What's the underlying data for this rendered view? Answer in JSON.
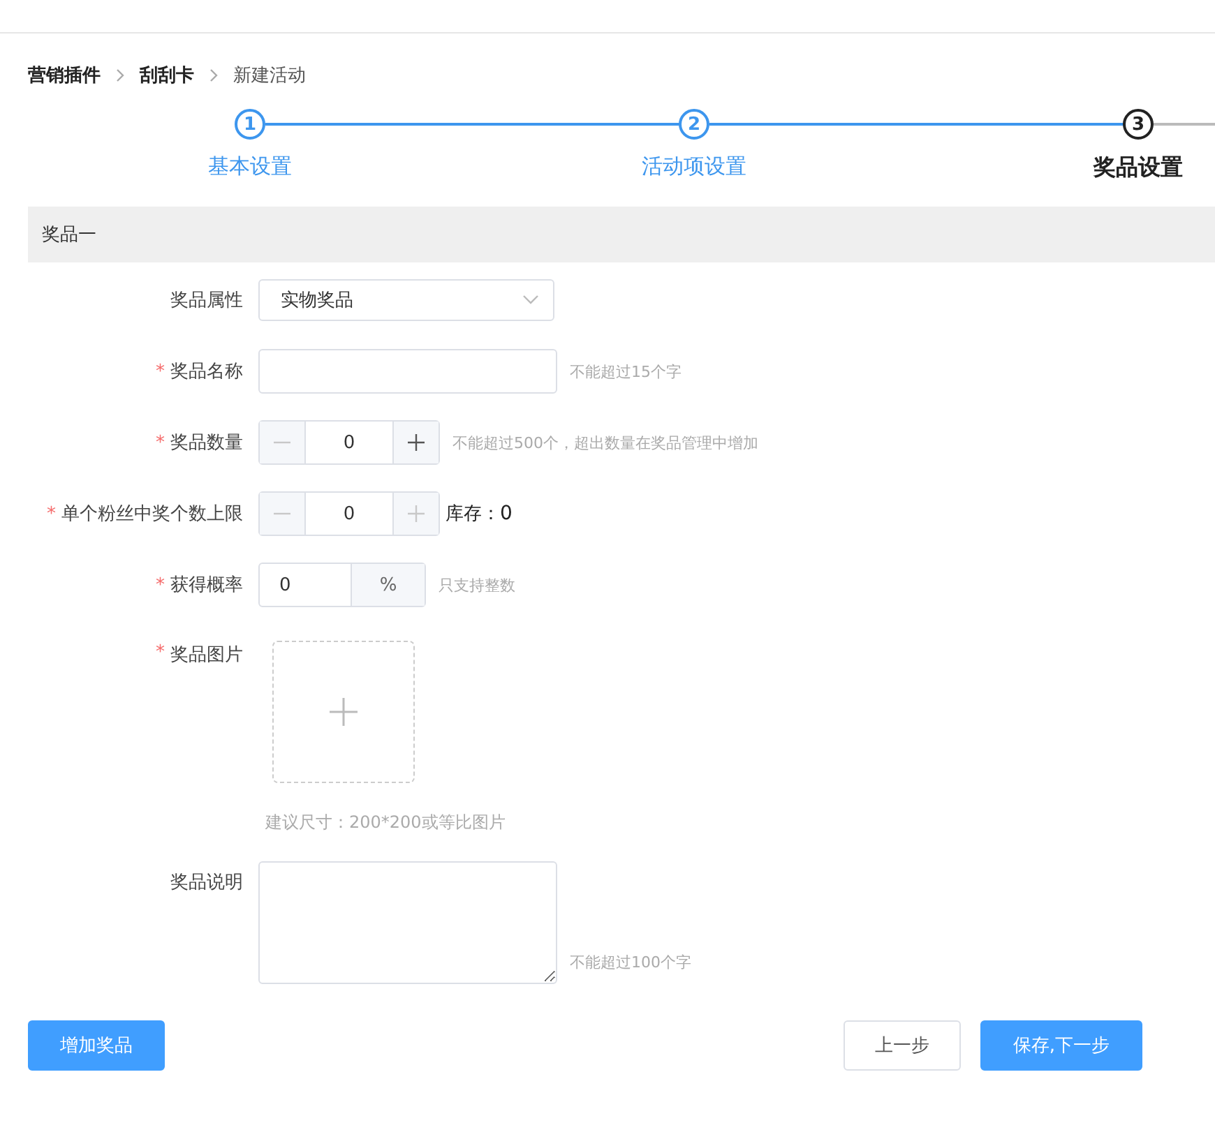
{
  "breadcrumb": [
    {
      "label": "营销插件",
      "current": false
    },
    {
      "label": "刮刮卡",
      "current": false
    },
    {
      "label": "新建活动",
      "current": true
    }
  ],
  "steps": [
    {
      "number": "1",
      "label": "基本设置",
      "completed": true
    },
    {
      "number": "2",
      "label": "活动项设置",
      "completed": true
    },
    {
      "number": "3",
      "label": "奖品设置",
      "completed": false
    }
  ],
  "section_title": "奖品一",
  "fields": [
    {
      "kind": "select",
      "label": "奖品属性",
      "value": "实物奖品"
    },
    {
      "kind": "text",
      "label": "奖品名称",
      "required_mark": "*",
      "hint": "不能超过15个字"
    },
    {
      "kind": "stepper",
      "label": "奖品数量",
      "required_mark": "*",
      "value": "0",
      "minus_disabled": true,
      "plus_disabled": false,
      "hint": "不能超过500个，超出数量在奖品管理中增加"
    },
    {
      "kind": "stepper",
      "label": "单个粉丝中奖个数上限",
      "required_mark": "*",
      "value": "0",
      "minus_disabled": true,
      "plus_disabled": true,
      "stock_label": "库存：",
      "stock_value": "0"
    },
    {
      "kind": "percent",
      "label": "获得概率",
      "required_mark": "*",
      "value": "0",
      "unit": "%",
      "hint": "只支持整数"
    },
    {
      "kind": "upload",
      "label": "奖品图片",
      "required_mark": "*",
      "hint": "建议尺寸：200*200或等比图片"
    },
    {
      "kind": "textarea",
      "label": "奖品说明",
      "hint": "不能超过100个字"
    }
  ],
  "buttons": [
    {
      "label": "增加奖品",
      "kind": "primary"
    },
    {
      "label": "上一步",
      "kind": "default"
    },
    {
      "label": "保存,下一步",
      "kind": "primary"
    }
  ]
}
